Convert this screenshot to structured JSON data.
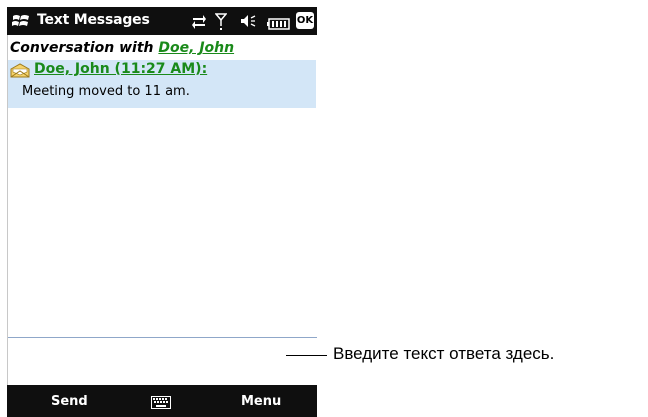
{
  "titlebar": {
    "app_title": "Text Messages",
    "ok_label": "OK",
    "icons": [
      "windows-start-icon",
      "data-connection-icon",
      "signal-antenna-icon",
      "speaker-muted-icon",
      "battery-icon"
    ]
  },
  "conversation": {
    "header_prefix": "Conversation with ",
    "contact_name": "Doe, John"
  },
  "messages": [
    {
      "from": "Doe, John (11:27 AM):",
      "text": "Meeting moved to 11 am.",
      "icon": "opened-envelope-icon"
    }
  ],
  "reply": {
    "value": ""
  },
  "softkeys": {
    "left": "Send",
    "right": "Menu",
    "center_icon": "keyboard-icon"
  },
  "callout": {
    "text": "Введите текст ответа здесь."
  },
  "colors": {
    "bar_bg": "#0f0f0f",
    "link_green": "#1a8a1a",
    "message_highlight": "#d3e6f7",
    "reply_border": "#8fa7c9"
  }
}
